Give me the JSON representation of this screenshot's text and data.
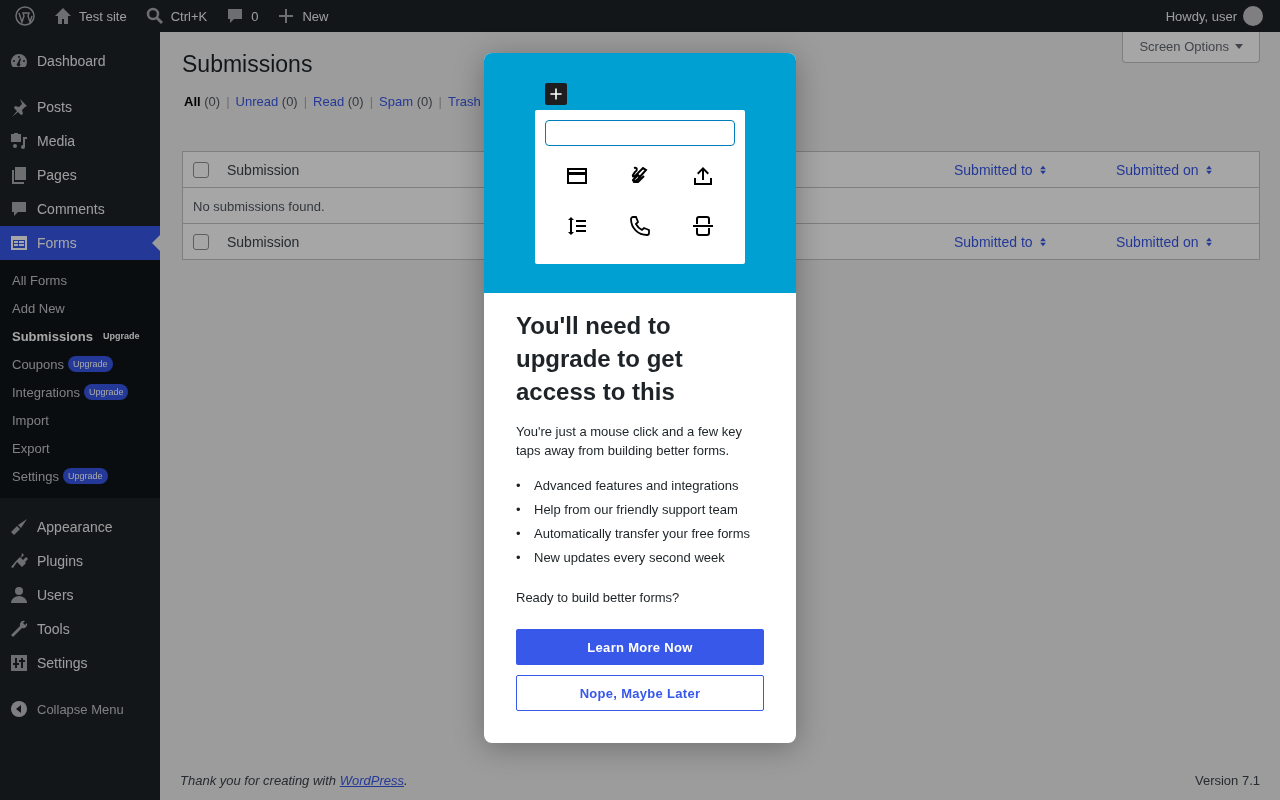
{
  "admin_bar": {
    "site": "Test site",
    "search": "Ctrl+K",
    "comments": "0",
    "new": "New",
    "greeting": "Howdy, user"
  },
  "sidebar": {
    "groups": [
      [
        {
          "label": "Dashboard",
          "selected": false
        }
      ],
      [
        {
          "label": "Posts",
          "selected": false
        },
        {
          "label": "Media",
          "selected": false
        },
        {
          "label": "Pages",
          "selected": false
        },
        {
          "label": "Comments",
          "selected": false
        },
        {
          "label": "Forms",
          "selected": true,
          "submenu": [
            {
              "label": "All Forms",
              "selected": false
            },
            {
              "label": "Add New",
              "selected": false
            },
            {
              "label": "Submissions",
              "selected": true,
              "badge": "Upgrade"
            },
            {
              "label": "Coupons",
              "selected": false,
              "badge": "Upgrade"
            },
            {
              "label": "Integrations",
              "selected": false,
              "badge": "Upgrade"
            },
            {
              "label": "Import",
              "selected": false
            },
            {
              "label": "Export",
              "selected": false
            },
            {
              "label": "Settings",
              "selected": false,
              "badge": "Upgrade"
            }
          ]
        }
      ],
      [
        {
          "label": "Appearance",
          "selected": false
        },
        {
          "label": "Plugins",
          "selected": false
        },
        {
          "label": "Users",
          "selected": false
        },
        {
          "label": "Tools",
          "selected": false
        },
        {
          "label": "Settings",
          "selected": false
        }
      ]
    ],
    "collapse": "Collapse Menu"
  },
  "page": {
    "title": "Submissions",
    "screen_options": "Screen Options",
    "filters": [
      {
        "label": "All",
        "count": "(0)",
        "selected": true
      },
      {
        "separator": "|",
        "label": "Unread",
        "count": "(0)",
        "selected": false
      },
      {
        "separator": "|",
        "label": "Read",
        "count": "(0)",
        "selected": false
      },
      {
        "separator": "|",
        "label": "Spam",
        "count": "(0)",
        "selected": false
      },
      {
        "separator": "|",
        "label": "Trash",
        "selected": false
      }
    ],
    "table": {
      "header": {
        "select_all_checked": false,
        "columns": [
          {
            "label": "Submission",
            "sortable": false
          },
          {
            "label": "Submitted to",
            "sortable": true
          },
          {
            "label": "Submitted on",
            "sortable": true
          }
        ]
      },
      "empty": "No submissions found.",
      "footer": {
        "select_all_checked": false,
        "columns": [
          {
            "label": "Submission",
            "sortable": false
          },
          {
            "label": "Submitted to",
            "sortable": true
          },
          {
            "label": "Submitted on",
            "sortable": true
          }
        ]
      }
    },
    "footer": {
      "text": "Thank you for creating with ",
      "link": "WordPress",
      "after": ".",
      "version": "Version 7.1"
    }
  },
  "modal": {
    "heading": "You'll need to upgrade to get access to this",
    "body": "You're just a mouse click and a few key taps away from building better forms.",
    "bullets": [
      {
        "marker": "•",
        "text": "Advanced features and integrations"
      },
      {
        "marker": "•",
        "text": "Help from our friendly support team"
      },
      {
        "marker": "•",
        "text": "Automatically transfer your free forms"
      },
      {
        "marker": "•",
        "text": "New updates every second week"
      }
    ],
    "question": "Ready to build better forms?",
    "primary": "Learn More Now",
    "secondary": "Nope, Maybe Later"
  }
}
